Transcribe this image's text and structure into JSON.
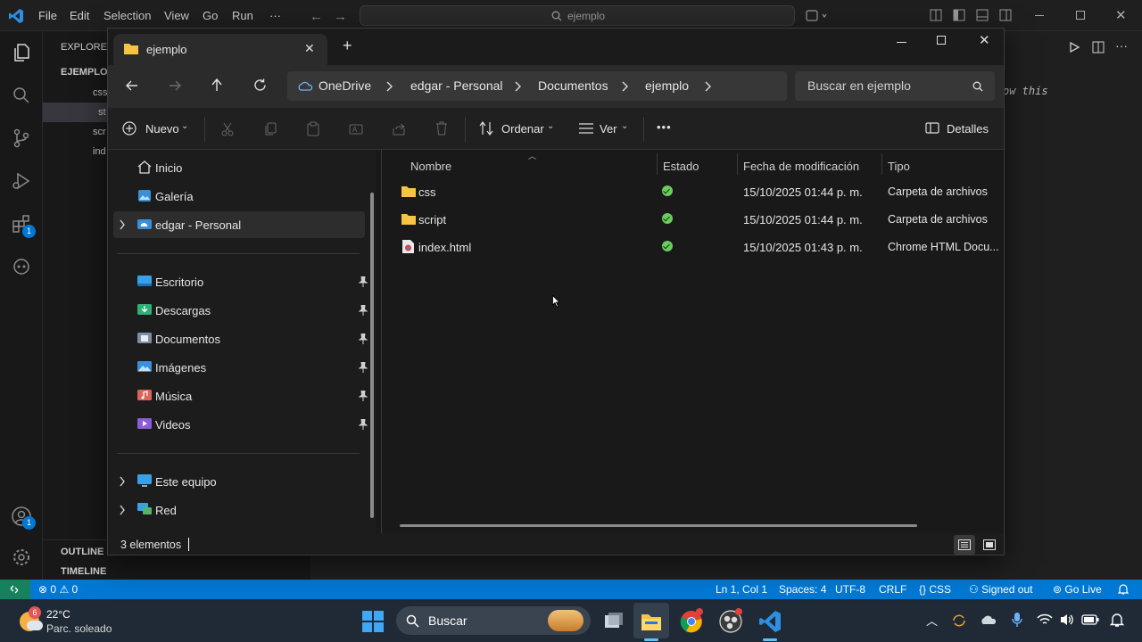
{
  "vscode": {
    "menu": [
      "File",
      "Edit",
      "Selection",
      "View",
      "Go",
      "Run",
      "···"
    ],
    "search_text": "ejemplo",
    "explorer_header": "EXPLORER",
    "project": "EJEMPLO",
    "tree": [
      "css",
      "st",
      "scr",
      "ind"
    ],
    "outline": "OUTLINE",
    "timeline": "TIMELINE",
    "editor_ghost_text": "ow this",
    "badges": {
      "extensions": "1",
      "accounts": "1"
    }
  },
  "explorer": {
    "tab_title": "ejemplo",
    "breadcrumbs": [
      "OneDrive",
      "edgar - Personal",
      "Documentos",
      "ejemplo"
    ],
    "search_placeholder": "Buscar en ejemplo",
    "toolbar": {
      "new": "Nuevo",
      "sort": "Ordenar",
      "view": "Ver",
      "more": "•••",
      "details": "Detalles"
    },
    "nav": {
      "top": [
        "Inicio",
        "Galería",
        "edgar - Personal"
      ],
      "pinned": [
        "Escritorio",
        "Descargas",
        "Documentos",
        "Imágenes",
        "Música",
        "Videos"
      ],
      "bottom": [
        "Este equipo",
        "Red"
      ]
    },
    "columns": [
      "Nombre",
      "Estado",
      "Fecha de modificación",
      "Tipo"
    ],
    "files": [
      {
        "name": "css",
        "date": "15/10/2025 01:44 p. m.",
        "type": "Carpeta de archivos"
      },
      {
        "name": "script",
        "date": "15/10/2025 01:44 p. m.",
        "type": "Carpeta de archivos"
      },
      {
        "name": "index.html",
        "date": "15/10/2025 01:43 p. m.",
        "type": "Chrome HTML Docu..."
      }
    ],
    "item_count": "3 elementos"
  },
  "statusbar": {
    "problems": "0",
    "warnings": "0",
    "position": "Ln 1, Col 1",
    "spaces": "Spaces: 4",
    "encoding": "UTF-8",
    "eol": "CRLF",
    "language": "CSS",
    "account": "Signed out",
    "golive": "Go Live"
  },
  "taskbar": {
    "weather_temp": "22°C",
    "weather_desc": "Parc. soleado",
    "weather_badge": "6",
    "search": "Buscar"
  },
  "colors": {
    "accent": "#0078d4",
    "folder": "#f6c344",
    "status_ok": "#6ccb5f",
    "taskbar": "#202a36"
  }
}
